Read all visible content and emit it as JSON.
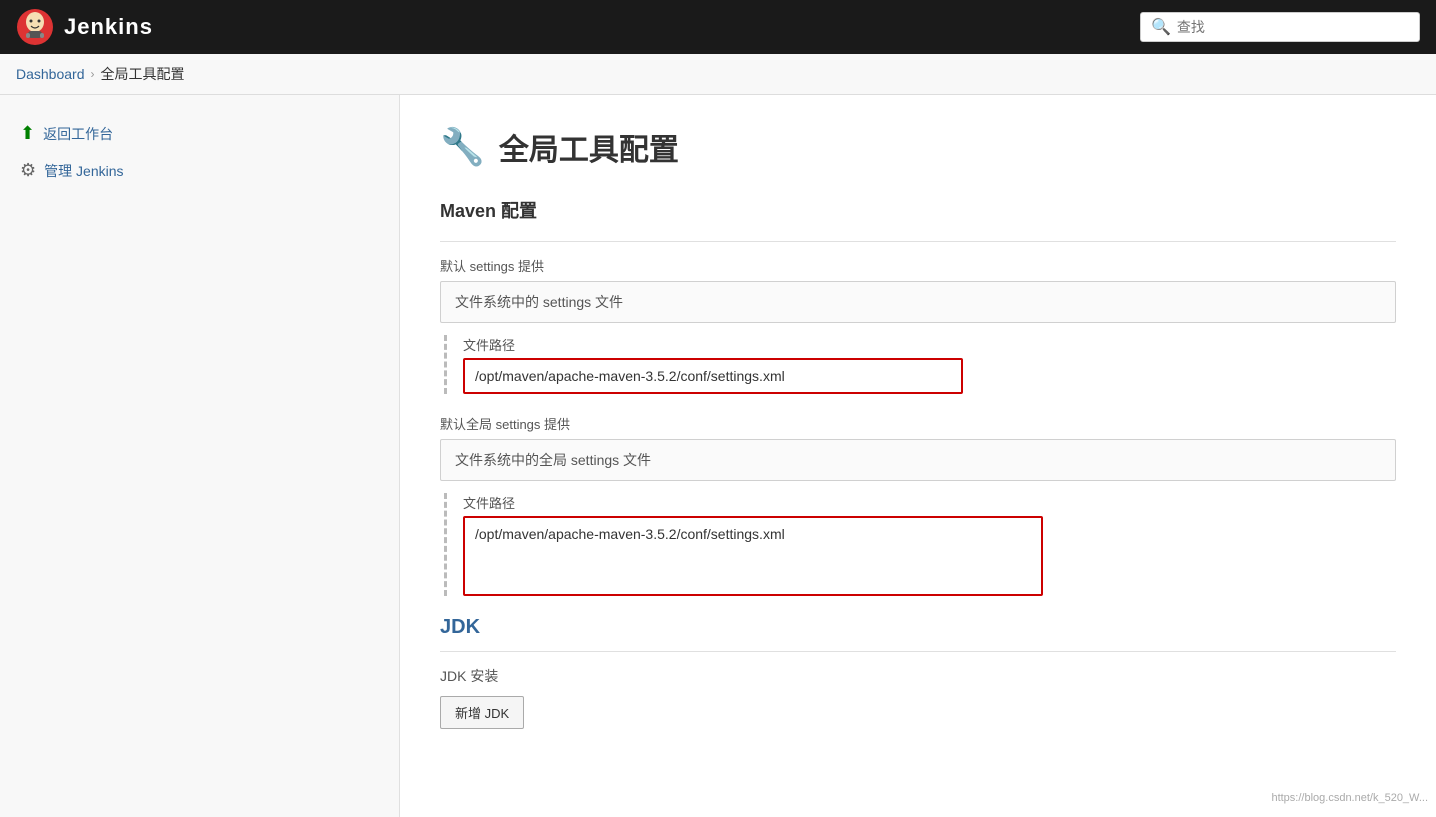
{
  "header": {
    "title": "Jenkins",
    "search_placeholder": "查找"
  },
  "breadcrumb": {
    "home": "Dashboard",
    "separator": "›",
    "current": "全局工具配置"
  },
  "sidebar": {
    "items": [
      {
        "id": "back-to-workspace",
        "icon": "⬆",
        "label": "返回工作台",
        "color": "green"
      },
      {
        "id": "manage-jenkins",
        "icon": "⚙",
        "label": "管理 Jenkins",
        "color": "default"
      }
    ]
  },
  "main": {
    "page_title": "全局工具配置",
    "page_title_icon": "🔧",
    "sections": [
      {
        "id": "maven-config",
        "title": "Maven 配置",
        "groups": [
          {
            "id": "default-settings",
            "label": "默认 settings 提供",
            "dropdown_value": "文件系统中的 settings 文件",
            "sub_field_label": "文件路径",
            "sub_field_value": "/opt/maven/apache-maven-3.5.2/conf/settings.xml",
            "input_type": "single"
          },
          {
            "id": "default-global-settings",
            "label": "默认全局 settings 提供",
            "dropdown_value": "文件系统中的全局 settings 文件",
            "sub_field_label": "文件路径",
            "sub_field_value": "/opt/maven/apache-maven-3.5.2/conf/settings.xml",
            "input_type": "multi"
          }
        ]
      },
      {
        "id": "jdk",
        "title": "JDK",
        "sub_label": "JDK 安装",
        "add_button_label": "新增 JDK"
      }
    ]
  }
}
